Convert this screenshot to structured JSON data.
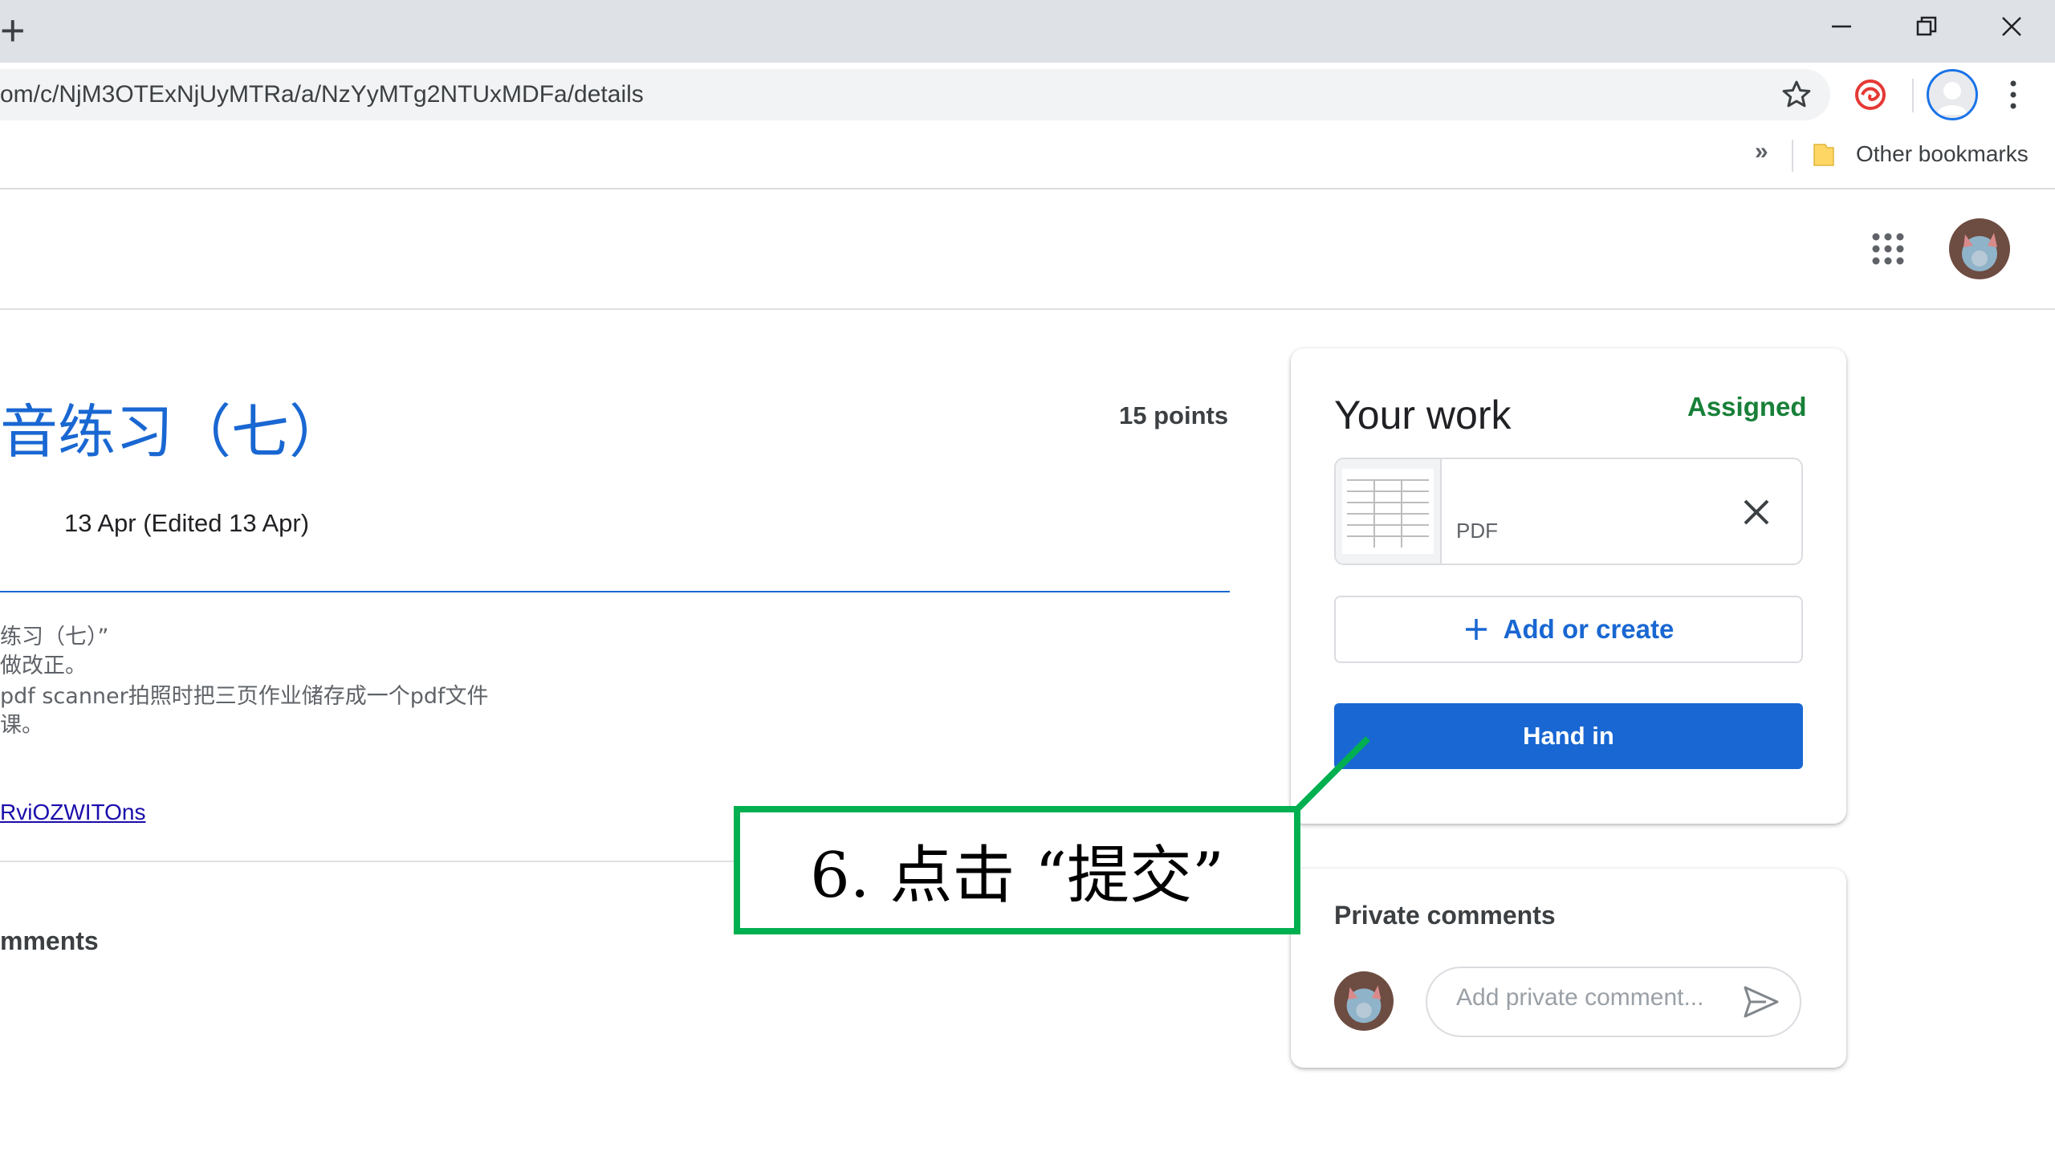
{
  "browser": {
    "new_tab": "+",
    "url": "om/c/NjM3OTExNjUyMTRa/a/NzYyMTg2NTUxMDFa/details",
    "bookmarks": {
      "overflow": "»",
      "other": "Other bookmarks"
    }
  },
  "assignment": {
    "title": "音练习（七）",
    "points": "15 points",
    "date": "13 Apr (Edited 13 Apr)",
    "description": [
      "练习（七）”",
      "做改正。",
      "pdf scanner拍照时把三页作业储存成一个pdf文件",
      "课。"
    ],
    "link": "RviOZWITOns",
    "class_comments": "mments"
  },
  "your_work": {
    "title": "Your work",
    "status": "Assigned",
    "attachment_label": "PDF",
    "add_label": "Add or create",
    "hand_in_label": "Hand in"
  },
  "private_comments": {
    "title": "Private comments",
    "placeholder": "Add private comment..."
  },
  "annotation": {
    "text": "6. 点击 “提交”"
  },
  "colors": {
    "accent": "#1967d2",
    "assigned": "#188038",
    "annotation_border": "#00b050"
  },
  "icons": [
    "plus-icon",
    "minimize-icon",
    "restore-icon",
    "close-icon",
    "star-icon",
    "extension-icon",
    "profile-icon",
    "more-vert-icon",
    "folder-icon",
    "apps-icon",
    "avatar",
    "remove-attachment-icon",
    "send-icon"
  ]
}
